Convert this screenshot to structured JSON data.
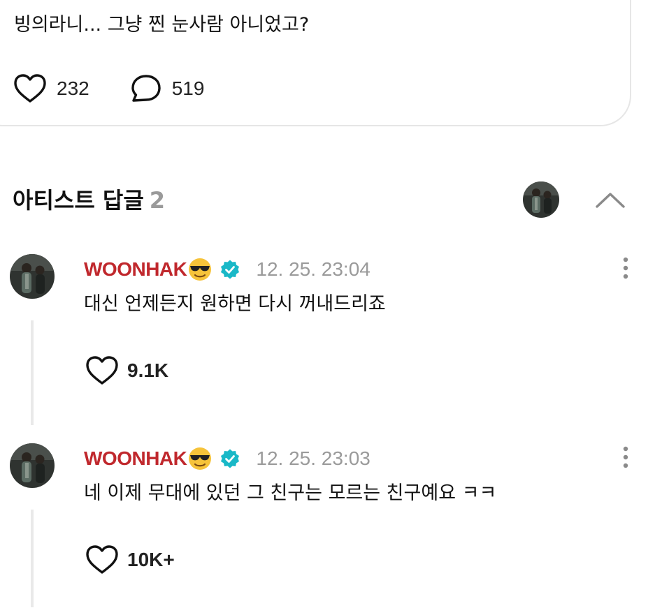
{
  "post": {
    "text": "빙의라니... 그냥 찐 눈사람 아니었고?",
    "likes": "232",
    "comments": "519"
  },
  "section": {
    "title": "아티스트 답글",
    "count": "2"
  },
  "replies": [
    {
      "author": "WOONHAK",
      "timestamp": "12. 25. 23:04",
      "text": "대신 언제든지 원하면 다시 꺼내드리죠",
      "likes": "9.1K"
    },
    {
      "author": "WOONHAK",
      "timestamp": "12. 25. 23:03",
      "text": "네 이제 무대에 있던 그 친구는 모르는 친구예요 ㅋㅋ",
      "likes": "10K+"
    }
  ],
  "colors": {
    "author": "#c0282d",
    "verified": "#19b8c7",
    "muted": "#9a9a9a"
  },
  "icons": {
    "like": "heart-outline-icon",
    "comment": "speech-bubble-icon",
    "collapse": "chevron-up-icon",
    "more": "vertical-dots-icon",
    "verified": "verified-badge-icon",
    "emoji": "sunglasses-face-emoji"
  }
}
